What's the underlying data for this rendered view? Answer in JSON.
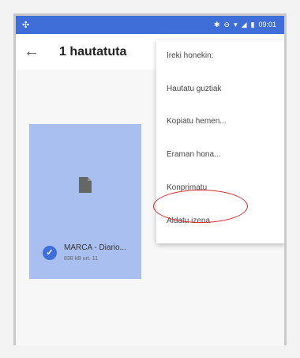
{
  "status": {
    "left_icon": "app-icon",
    "time": "09:01"
  },
  "appbar": {
    "title": "1 hautatuta",
    "back_icon": "arrow-left-icon"
  },
  "menu": {
    "items": [
      {
        "label": "Ireki honekin:"
      },
      {
        "label": "Hautatu guztiak"
      },
      {
        "label": "Kopiatu hemen..."
      },
      {
        "label": "Eraman hona..."
      },
      {
        "label": "Konprimatu"
      },
      {
        "label": "Aldatu izena"
      }
    ]
  },
  "file": {
    "name": "MARCA - Diario...",
    "meta": "838 kB  urt. 11"
  },
  "colors": {
    "accent": "#3f6ed8",
    "card": "#a8bff0",
    "highlight": "#d9272e"
  }
}
